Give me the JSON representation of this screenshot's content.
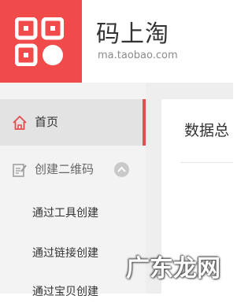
{
  "brand": {
    "title": "码上淘",
    "subtitle": "ma.taobao.com",
    "accent_color": "#f04a4a"
  },
  "sidebar": {
    "active_indicator_color": "#e84b4b",
    "items": [
      {
        "label": "首页",
        "icon": "home-icon",
        "active": true
      },
      {
        "label": "创建二维码",
        "icon": "edit-icon",
        "expanded": true,
        "chevron": "chevron-up-icon",
        "children": [
          {
            "label": "通过工具创建"
          },
          {
            "label": "通过链接创建"
          },
          {
            "label": "通过宝贝创建"
          }
        ]
      }
    ]
  },
  "main": {
    "title": "数据总"
  },
  "watermark": {
    "text": "广东龙网"
  }
}
